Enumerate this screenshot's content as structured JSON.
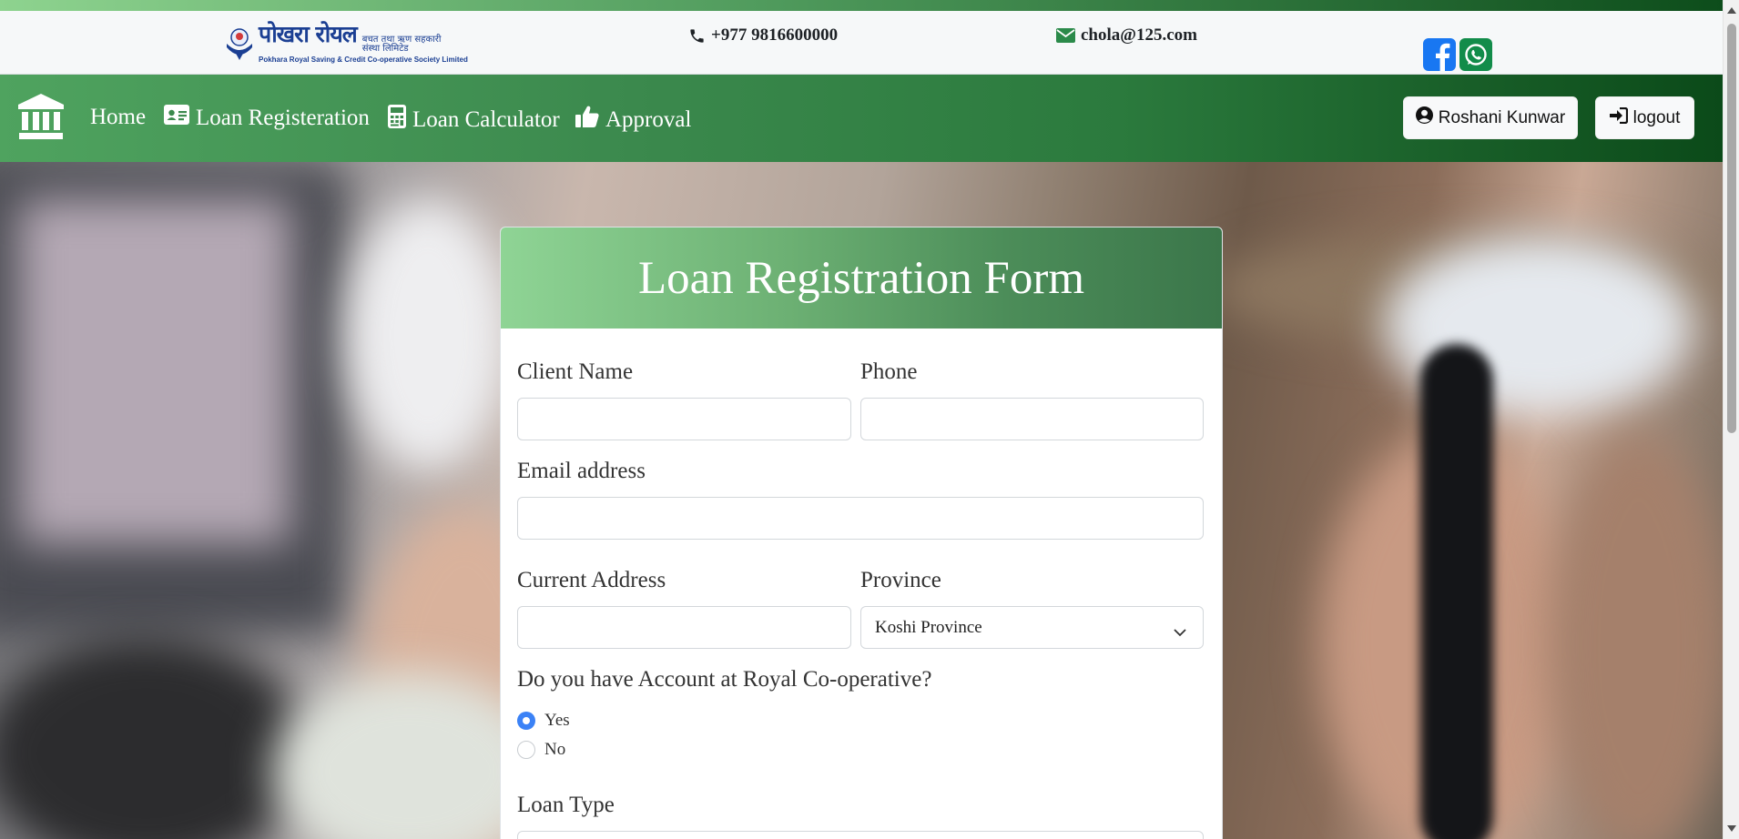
{
  "header": {
    "logo": {
      "name_devanagari": "पोखरा रोयल",
      "tagline_devanagari": "बचत तथा ऋण सहकारी संस्था लिमिटेड",
      "name_english": "Pokhara Royal Saving & Credit Co-operative Society Limited"
    },
    "phone": "+977 9816600000",
    "email": "chola@125.com",
    "social": [
      "facebook-icon",
      "whatsapp-icon"
    ]
  },
  "nav": {
    "items": [
      {
        "label": "Home",
        "icon": ""
      },
      {
        "label": "Loan Registeration",
        "icon": "id-card-icon"
      },
      {
        "label": "Loan Calculator",
        "icon": "calculator-icon"
      },
      {
        "label": "Approval",
        "icon": "thumbs-up-icon"
      }
    ],
    "user_label": "Roshani Kunwar",
    "logout_label": "logout"
  },
  "form": {
    "title": "Loan Registration Form",
    "client_name": {
      "label": "Client Name",
      "value": ""
    },
    "phone": {
      "label": "Phone",
      "value": ""
    },
    "email": {
      "label": "Email address",
      "value": ""
    },
    "current_address": {
      "label": "Current Address",
      "value": ""
    },
    "province": {
      "label": "Province",
      "selected": "Koshi Province"
    },
    "account_question": "Do you have Account at Royal Co-operative?",
    "account_options": [
      {
        "label": "Yes",
        "checked": true
      },
      {
        "label": "No",
        "checked": false
      }
    ],
    "loan_type": {
      "label": "Loan Type"
    }
  },
  "colors": {
    "brand_green": "#2b7a3d",
    "dark_green": "#0b4a19",
    "light_green": "#8fd495",
    "radio_blue": "#3b82f6",
    "facebook_blue": "#1877f2",
    "whatsapp_green": "#128c4a"
  }
}
